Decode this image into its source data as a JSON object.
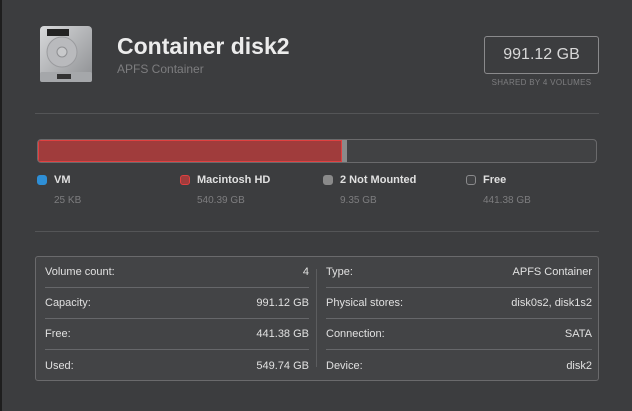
{
  "header": {
    "title": "Container disk2",
    "subtitle": "APFS Container",
    "size": "991.12 GB",
    "shared": "SHARED BY 4 VOLUMES"
  },
  "usage": {
    "total_gb": 991.12,
    "segments": [
      {
        "name": "VM",
        "value": "25 KB",
        "gb": 2.5e-05,
        "color": "#2e8fd6"
      },
      {
        "name": "Macintosh HD",
        "value": "540.39 GB",
        "gb": 540.39,
        "color": "#a03c3c"
      },
      {
        "name": "2 Not Mounted",
        "value": "9.35 GB",
        "gb": 9.35,
        "color": "#8a8a8a"
      },
      {
        "name": "Free",
        "value": "441.38 GB",
        "gb": 441.38,
        "color": "#414244"
      }
    ]
  },
  "details": {
    "left": [
      {
        "label": "Volume count:",
        "value": "4"
      },
      {
        "label": "Capacity:",
        "value": "991.12 GB"
      },
      {
        "label": "Free:",
        "value": "441.38 GB"
      },
      {
        "label": "Used:",
        "value": "549.74 GB"
      }
    ],
    "right": [
      {
        "label": "Type:",
        "value": "APFS Container"
      },
      {
        "label": "Physical stores:",
        "value": "disk0s2, disk1s2"
      },
      {
        "label": "Connection:",
        "value": "SATA"
      },
      {
        "label": "Device:",
        "value": "disk2"
      }
    ]
  }
}
